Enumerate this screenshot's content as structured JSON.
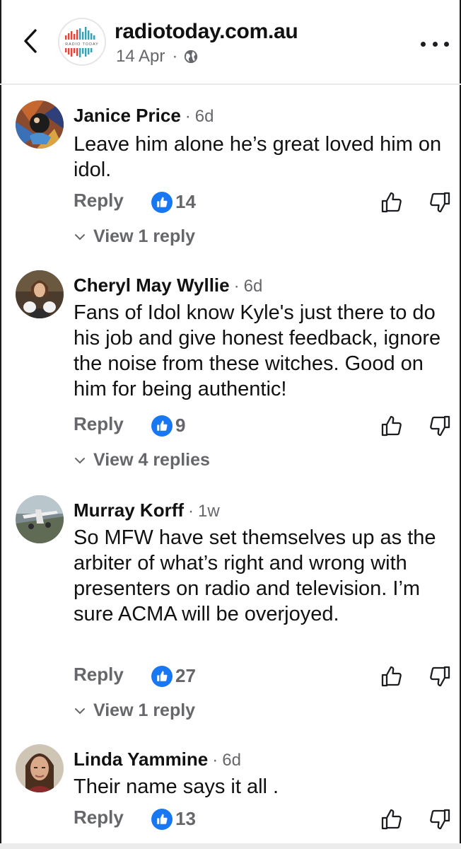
{
  "header": {
    "page_name": "radiotoday.com.au",
    "logo_text": "RADIO TODAY",
    "post_date": "14 Apr",
    "separator": "·",
    "icons": {
      "back": "chevron-left-icon",
      "globe": "globe-icon",
      "more": "more-horizontal-icon"
    }
  },
  "actions": {
    "reply_label": "Reply"
  },
  "comments": [
    {
      "author": "Janice Price",
      "time_ago": "6d",
      "text": "Leave him alone he’s great loved him on idol.",
      "likes": "14",
      "view_replies": "View 1 reply"
    },
    {
      "author": "Cheryl May Wyllie",
      "time_ago": "6d",
      "text": "Fans of Idol know Kyle's just there to do his job and give honest feedback, ignore the noise from these witches. Good on him for being authentic!",
      "likes": "9",
      "view_replies": "View 4 replies"
    },
    {
      "author": "Murray Korff",
      "time_ago": "1w",
      "text": "So MFW have set themselves up as the arbiter of what’s right and wrong with presenters on radio and television. I’m sure ACMA will be overjoyed.",
      "likes": "27",
      "view_replies": "View 1 reply"
    },
    {
      "author": "Linda Yammine",
      "time_ago": "6d",
      "text": "Their name says it all .",
      "likes": "13"
    }
  ],
  "colors": {
    "like_blue": "#1877f2",
    "secondary_text": "#65676b",
    "primary_text": "#111111",
    "logo_bar_red": "#e0473c",
    "logo_bar_teal": "#3a9fb5"
  }
}
